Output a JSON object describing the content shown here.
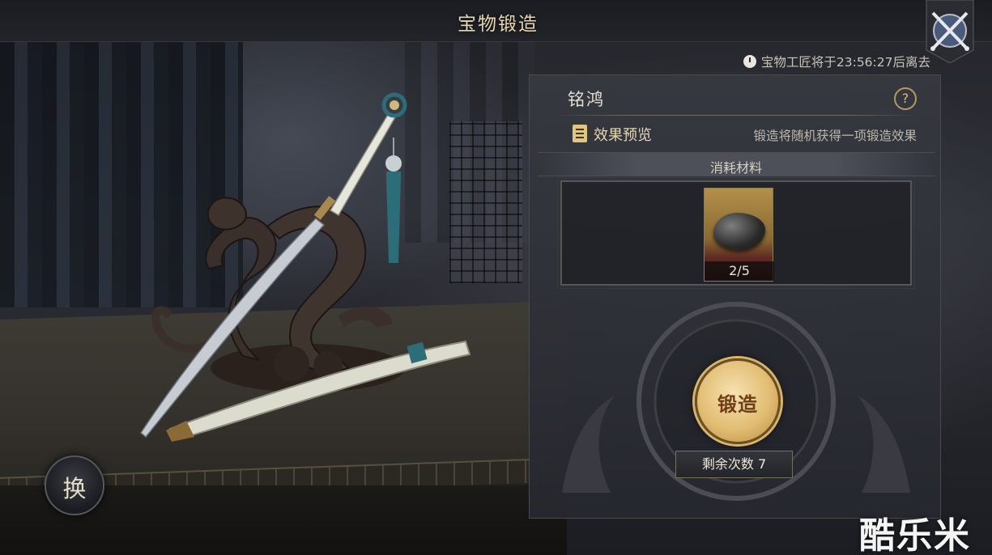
{
  "header": {
    "title": "宝物锻造",
    "close_icon": "crossed-swords-icon"
  },
  "timer": {
    "icon": "clock-icon",
    "text": "宝物工匠将于23:56:27后离去"
  },
  "panel": {
    "treasure_name": "铭鸿",
    "help_label": "?",
    "preview": {
      "icon": "document-icon",
      "label": "效果预览",
      "description": "锻造将随机获得一项锻造效果"
    },
    "materials": {
      "label": "消耗材料",
      "items": [
        {
          "icon": "iron-ore-icon",
          "count": "2/5"
        }
      ]
    },
    "forge": {
      "button_label": "锻造",
      "remaining_text": "剩余次数 7"
    }
  },
  "swap": {
    "label": "换"
  },
  "watermark": {
    "text": "酷乐米"
  },
  "colors": {
    "accent_gold": "#e2bd73",
    "title_text": "#e6d7b1",
    "panel_bg": "#37393f"
  }
}
